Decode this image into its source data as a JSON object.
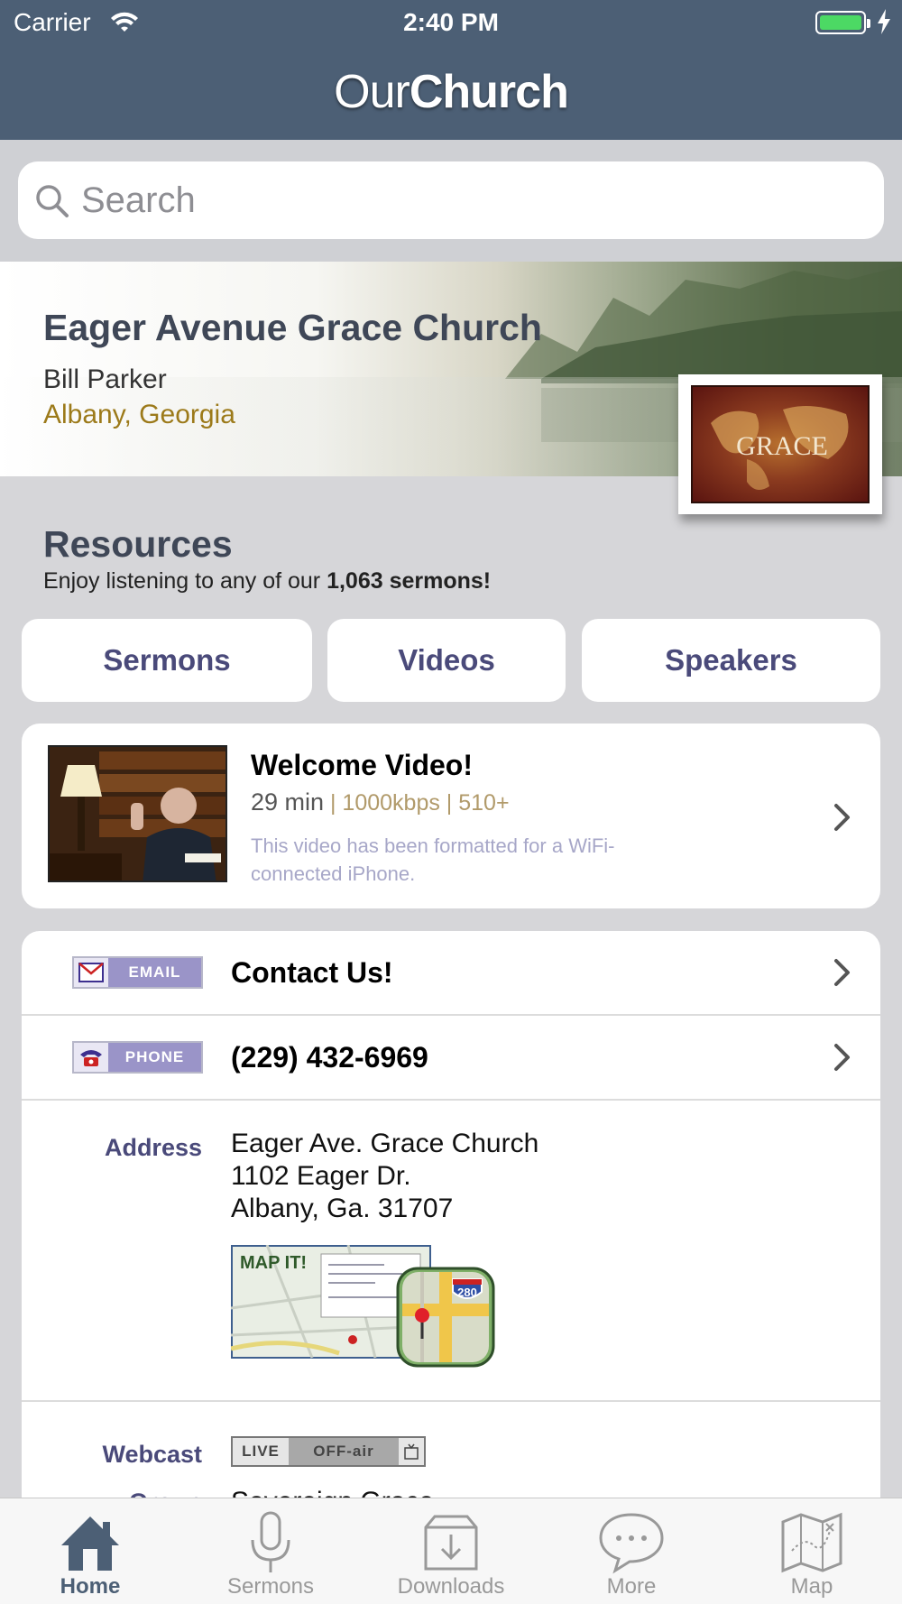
{
  "status_bar": {
    "carrier": "Carrier",
    "time": "2:40 PM"
  },
  "nav": {
    "logo_part1": "Our",
    "logo_part2": "Church"
  },
  "search": {
    "placeholder": "Search"
  },
  "church": {
    "name": "Eager Avenue Grace Church",
    "pastor": "Bill Parker",
    "location": "Albany, Georgia",
    "badge_text": "GRACE"
  },
  "resources": {
    "title": "Resources",
    "subtitle_prefix": "Enjoy listening to any of our ",
    "sermon_count": "1,063 sermons!",
    "buttons": [
      {
        "label": "Sermons"
      },
      {
        "label": "Videos"
      },
      {
        "label": "Speakers"
      }
    ]
  },
  "welcome_video": {
    "title": "Welcome Video!",
    "duration": "29 min",
    "meta": " | 1000kbps | 510+",
    "description": "This video has been formatted for a WiFi-connected iPhone."
  },
  "contact": {
    "email_tag": "EMAIL",
    "email_label": "Contact Us!",
    "phone_tag": "PHONE",
    "phone_label": "(229) 432-6969"
  },
  "address": {
    "label": "Address",
    "line1": "Eager Ave. Grace Church",
    "line2": "1102 Eager Dr.",
    "line3": "Albany, Ga. 31707",
    "map_button": "MAP IT!",
    "route_shield": "280"
  },
  "webcast": {
    "label": "Webcast",
    "live": "LIVE",
    "status": "OFF-air"
  },
  "group": {
    "label": "Group",
    "value": "Sovereign Grace"
  },
  "tabs": [
    {
      "label": "Home",
      "icon": "home-icon",
      "active": true
    },
    {
      "label": "Sermons",
      "icon": "microphone-icon"
    },
    {
      "label": "Downloads",
      "icon": "downloads-icon"
    },
    {
      "label": "More",
      "icon": "chat-bubble-icon"
    },
    {
      "label": "Map",
      "icon": "map-icon"
    }
  ],
  "colors": {
    "nav_bar": "#4c5f75",
    "heading": "#3f4757",
    "accent_purple": "#4a4a7a",
    "location_gold": "#9c7a1a",
    "tab_active": "#4c5f75"
  }
}
